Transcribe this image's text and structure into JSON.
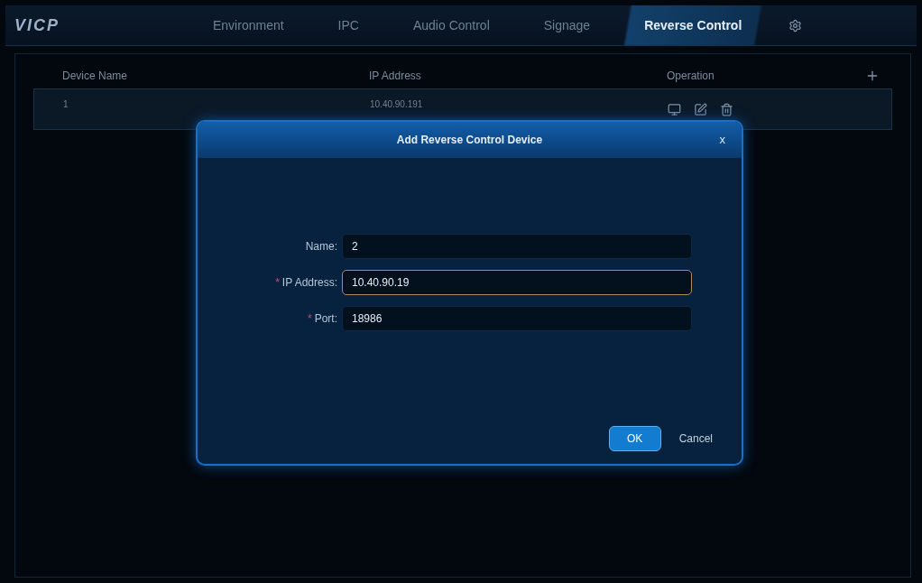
{
  "app": {
    "logo": "VICP"
  },
  "tabs": [
    {
      "label": "Environment",
      "selected": false
    },
    {
      "label": "IPC",
      "selected": false
    },
    {
      "label": "Audio Control",
      "selected": false
    },
    {
      "label": "Signage",
      "selected": false
    },
    {
      "label": "Reverse Control",
      "selected": true
    }
  ],
  "table": {
    "columns": [
      "Device Name",
      "IP Address",
      "Operation"
    ],
    "rows": [
      {
        "name": "1",
        "ip": "10.40.90.191"
      }
    ]
  },
  "dialog": {
    "title": "Add Reverse Control Device",
    "close": "x",
    "fields": [
      {
        "label": "Name:",
        "value": "2",
        "required": false,
        "focused": false
      },
      {
        "label": "IP Address:",
        "value": "10.40.90.19",
        "required": true,
        "focused": true
      },
      {
        "label": "Port:",
        "value": "18986",
        "required": true,
        "focused": false
      }
    ],
    "buttons": [
      {
        "label": "OK",
        "kind": "primary"
      },
      {
        "label": "Cancel",
        "kind": "plain"
      }
    ],
    "required_mark": "*"
  }
}
